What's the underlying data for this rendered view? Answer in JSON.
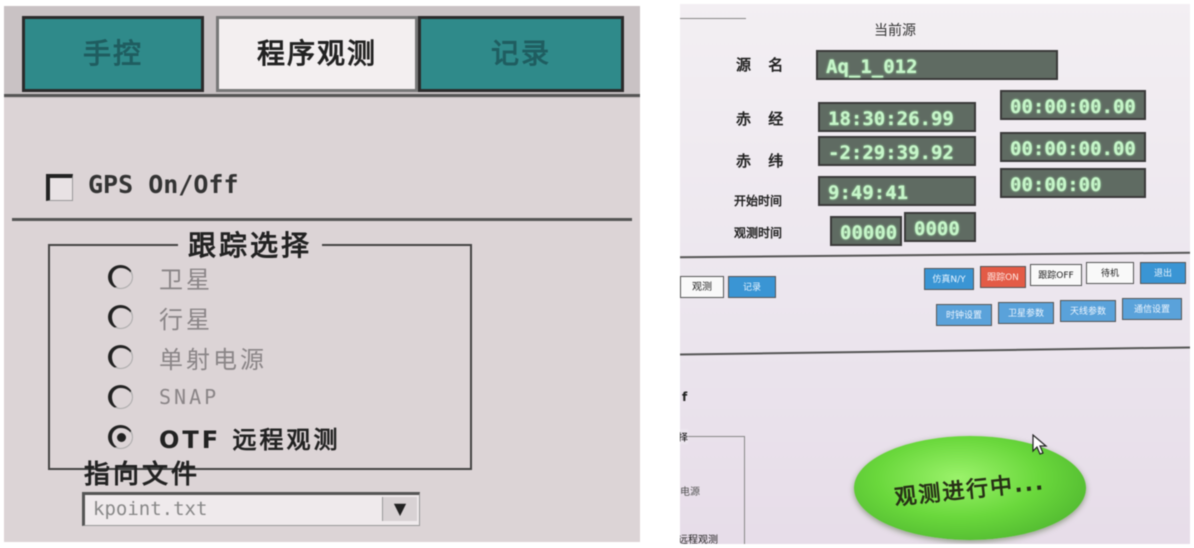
{
  "left_panel": {
    "tabs": [
      "手控",
      "程序观测",
      "记录"
    ],
    "gps_label": "GPS On/Off",
    "tracking": {
      "title": "跟踪选择",
      "options": [
        "卫星",
        "行星",
        "单射电源",
        "SNAP",
        "OTF 远程观测"
      ]
    },
    "pointing": {
      "title": "指向文件",
      "value": "kpoint.txt"
    }
  },
  "right_panel": {
    "current_source_title": "当前源",
    "source_name_label": "源 名",
    "source_name": "Aq_1_012",
    "ra_label": "赤 经",
    "ra": "18:30:26.99",
    "ra_offset": "00:00:00.00",
    "dec_label": "赤 纬",
    "dec": "-2:29:39.92",
    "dec_offset": "00:00:00.00",
    "start_label": "开始时间",
    "start": "9:49:41",
    "start2": "00:00:00",
    "obs_label": "观测时间",
    "obs1": "00000",
    "obs2": "0000",
    "mini_tab1": "观测",
    "mini_tab2": "记录",
    "row1": [
      "仿真N/Y",
      "跟踪ON",
      "跟踪OFF",
      "待机",
      "退出"
    ],
    "row2": [
      "时钟设置",
      "卫星参数",
      "天线参数",
      "通信设置"
    ],
    "f_label": "f",
    "group_label": "择",
    "side_text_1": "电源",
    "side_text_2": "远程观测",
    "observing_button": "观测进行中..."
  }
}
